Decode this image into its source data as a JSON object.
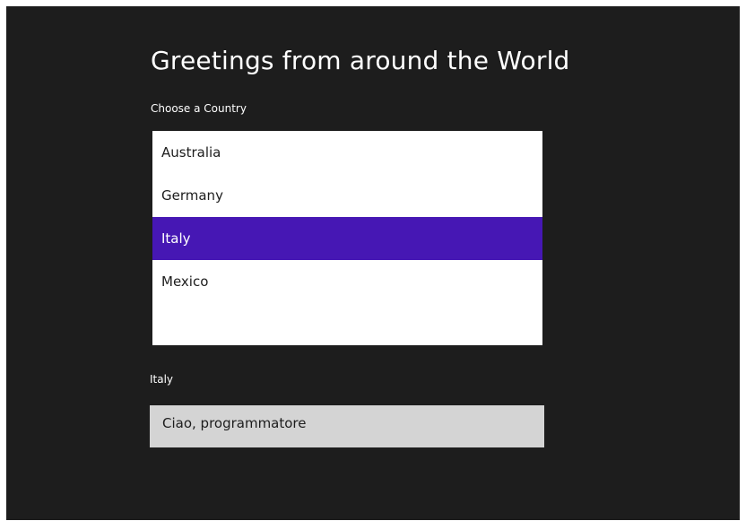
{
  "page": {
    "title": "Greetings from around the World",
    "choose_label": "Choose a Country",
    "selected_country": "Italy",
    "greeting": "Ciao, programmatore"
  },
  "countries": [
    {
      "name": "Australia",
      "selected": false
    },
    {
      "name": "Germany",
      "selected": false
    },
    {
      "name": "Italy",
      "selected": true
    },
    {
      "name": "Mexico",
      "selected": false
    }
  ],
  "colors": {
    "background": "#1d1d1d",
    "selection": "#4617b4",
    "list_background": "#ffffff",
    "greeting_background": "#d4d4d4"
  }
}
